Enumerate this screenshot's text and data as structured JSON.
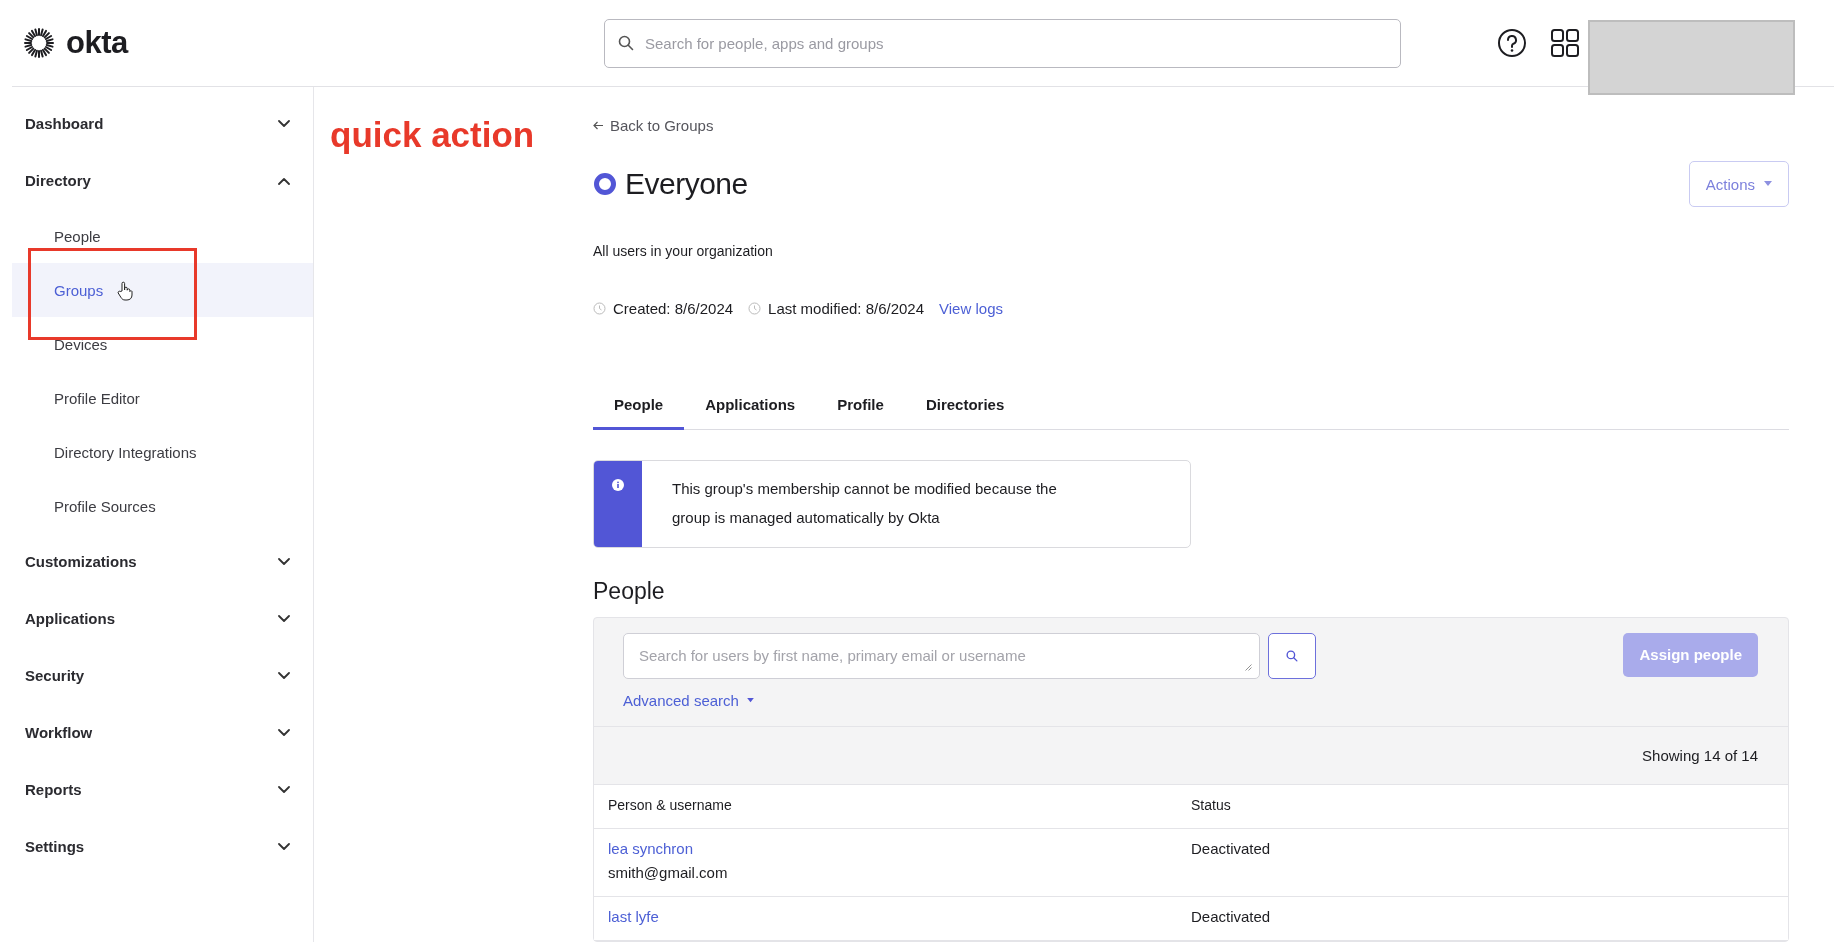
{
  "logo": {
    "text": "okta"
  },
  "search": {
    "placeholder": "Search for people, apps and groups"
  },
  "sidebar": {
    "items": [
      {
        "label": "Dashboard",
        "expanded": false
      },
      {
        "label": "Directory",
        "expanded": true,
        "children": [
          {
            "label": "People",
            "selected": false
          },
          {
            "label": "Groups",
            "selected": true
          },
          {
            "label": "Devices",
            "selected": false
          },
          {
            "label": "Profile Editor",
            "selected": false
          },
          {
            "label": "Directory Integrations",
            "selected": false
          },
          {
            "label": "Profile Sources",
            "selected": false
          }
        ]
      },
      {
        "label": "Customizations",
        "expanded": false
      },
      {
        "label": "Applications",
        "expanded": false
      },
      {
        "label": "Security",
        "expanded": false
      },
      {
        "label": "Workflow",
        "expanded": false
      },
      {
        "label": "Reports",
        "expanded": false
      },
      {
        "label": "Settings",
        "expanded": false
      }
    ]
  },
  "annotation": {
    "text": "quick action"
  },
  "page": {
    "back_link": "Back to Groups",
    "title": "Everyone",
    "actions_button": "Actions",
    "description": "All users in your organization",
    "created": "Created: 8/6/2024",
    "modified": "Last modified: 8/6/2024",
    "view_logs": "View logs",
    "tabs": [
      {
        "label": "People",
        "selected": true
      },
      {
        "label": "Applications",
        "selected": false
      },
      {
        "label": "Profile",
        "selected": false
      },
      {
        "label": "Directories",
        "selected": false
      }
    ],
    "notice": "This group's membership cannot be modified because the group is managed automatically by Okta",
    "section_title": "People",
    "people_search": {
      "placeholder": "Search for users by first name, primary email or username"
    },
    "advanced_search": "Advanced search",
    "assign_button": {
      "label": "Assign people",
      "disabled": true
    },
    "showing": "Showing 14 of 14",
    "table": {
      "columns": [
        "Person & username",
        "Status"
      ],
      "rows": [
        {
          "name": "lea synchron",
          "username": "smith@gmail.com",
          "status": "Deactivated"
        },
        {
          "name": "last lyfe",
          "status": "Deactivated"
        }
      ]
    }
  }
}
